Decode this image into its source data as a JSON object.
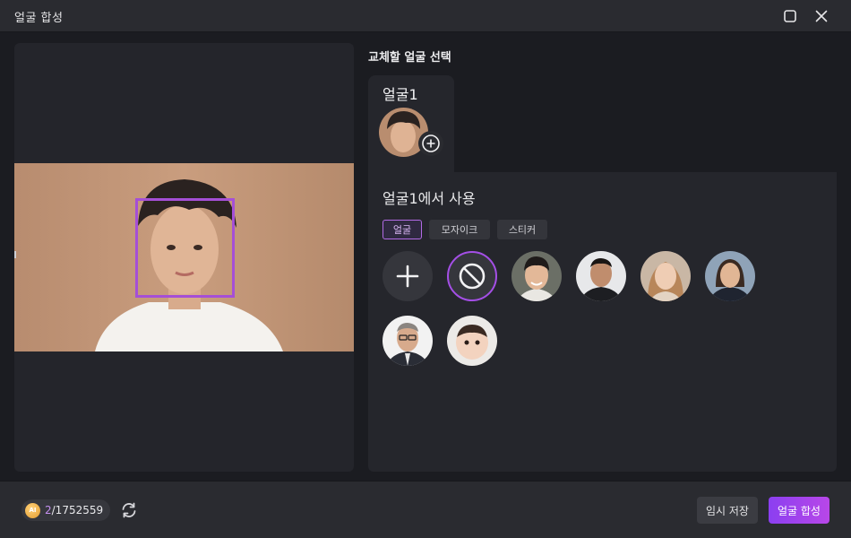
{
  "window": {
    "title": "얼굴 합성",
    "maximize_icon": "maximize-icon",
    "close_icon": "close-icon"
  },
  "right": {
    "title": "교체할 얼굴 선택",
    "face_tab_label": "얼굴1",
    "panel_heading": "얼굴1에서 사용",
    "chips": [
      "얼굴",
      "모자이크",
      "스티커"
    ],
    "active_chip": "얼굴"
  },
  "footer": {
    "credits_used": "2",
    "credits_total": "/1752559",
    "coin_label": "AI",
    "temp_save": "임시 저장",
    "synthesize": "얼굴 합성"
  },
  "colors": {
    "accent": "#a54fd6",
    "primary_button": "#9b42ec",
    "background": "#1b1c21",
    "panel": "#25262c"
  }
}
